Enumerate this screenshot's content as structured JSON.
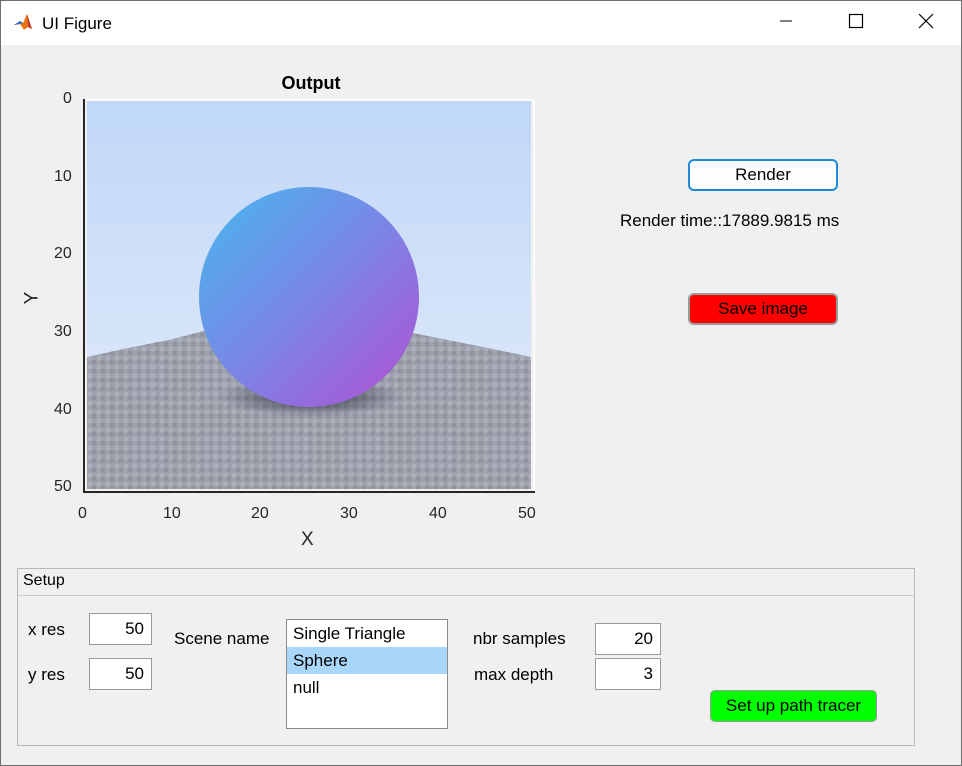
{
  "window": {
    "title": "UI Figure"
  },
  "axes": {
    "title": "Output",
    "xlabel": "X",
    "ylabel": "Y",
    "xticks": [
      "0",
      "10",
      "20",
      "30",
      "40",
      "50"
    ],
    "yticks": [
      "0",
      "10",
      "20",
      "30",
      "40",
      "50"
    ],
    "xlim": [
      0,
      50
    ],
    "ylim": [
      0,
      50
    ],
    "image": "rendered sphere scene",
    "colors": {
      "sky_top": "#c2d8f6",
      "sky_bottom": "#dfe9fb",
      "floor": "#9a9ea9",
      "sphere_left": "#4aa8ea",
      "sphere_right": "#a45ed6"
    }
  },
  "controls": {
    "render_label": "Render",
    "render_time": "Render time::17889.9815 ms",
    "save_label": "Save image"
  },
  "setup": {
    "title": "Setup",
    "xres_label": "x res",
    "xres_value": "50",
    "yres_label": "y res",
    "yres_value": "50",
    "scene_label": "Scene name",
    "scene_options": [
      "Single Triangle",
      "Sphere",
      "null"
    ],
    "scene_selected": "Sphere",
    "samples_label": "nbr samples",
    "samples_value": "20",
    "depth_label": "max depth",
    "depth_value": "3",
    "setup_button_label": "Set up path tracer",
    "setup_button_color": "#00ff00",
    "save_button_color": "#ff0000"
  }
}
